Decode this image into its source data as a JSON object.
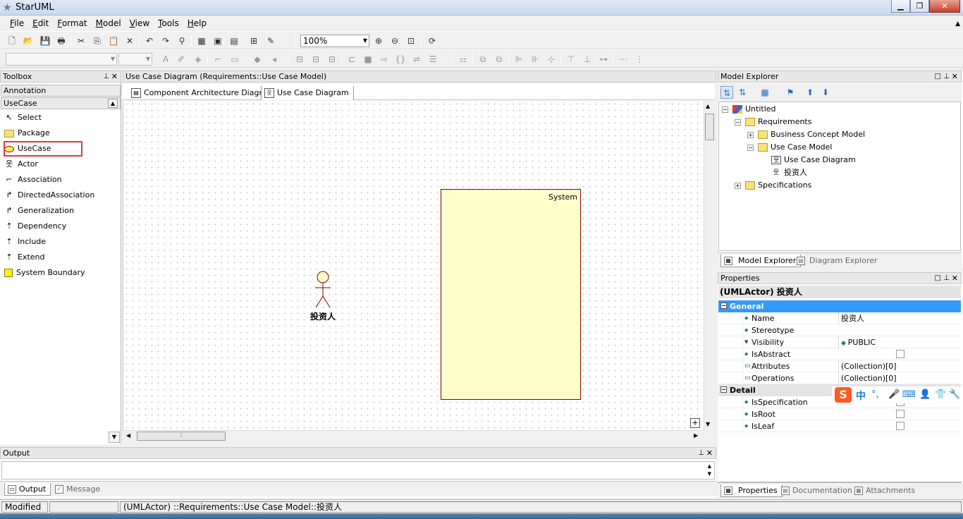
{
  "window": {
    "title": "StarUML",
    "minimize": "▁",
    "maximize": "❐",
    "close": "✕"
  },
  "menu": {
    "items": [
      {
        "first": "F",
        "rest": "ile"
      },
      {
        "first": "E",
        "rest": "dit"
      },
      {
        "first": "F",
        "rest": "ormat"
      },
      {
        "first": "M",
        "rest": "odel"
      },
      {
        "first": "V",
        "rest": "iew"
      },
      {
        "first": "T",
        "rest": "ools"
      },
      {
        "first": "H",
        "rest": "elp"
      }
    ]
  },
  "toolbar": {
    "zoom": "100%"
  },
  "toolbox": {
    "title": "Toolbox",
    "categories": [
      "Annotation",
      "UseCase"
    ],
    "items": [
      "Select",
      "Package",
      "UseCase",
      "Actor",
      "Association",
      "DirectedAssociation",
      "Generalization",
      "Dependency",
      "Include",
      "Extend",
      "System Boundary"
    ]
  },
  "diagram": {
    "title": "Use Case Diagram (Requirements::Use Case Model)",
    "tabs": [
      "Component Architecture Diagram",
      "Use Case Diagram"
    ],
    "system_label": "System",
    "actor_name": "投资人"
  },
  "output": {
    "title": "Output",
    "tabs": [
      "Output",
      "Message"
    ]
  },
  "model_explorer": {
    "title": "Model Explorer",
    "tree": {
      "root": "Untitled",
      "requirements": "Requirements",
      "business_concept_model": "Business Concept Model",
      "use_case_model": "Use Case Model",
      "use_case_diagram": "Use Case Diagram",
      "actor": "投资人",
      "specifications": "Specifications"
    },
    "tabs": [
      "Model Explorer",
      "Diagram Explorer"
    ]
  },
  "properties": {
    "title": "Properties",
    "header": "(UMLActor) 投资人",
    "general_label": "General",
    "detail_label": "Detail",
    "general": [
      {
        "key": "Name",
        "value": "投资人"
      },
      {
        "key": "Stereotype",
        "value": ""
      },
      {
        "key": "Visibility",
        "value": "PUBLIC"
      },
      {
        "key": "IsAbstract",
        "value": ""
      },
      {
        "key": "Attributes",
        "value": "(Collection)[0]"
      },
      {
        "key": "Operations",
        "value": "(Collection)[0]"
      }
    ],
    "detail": [
      {
        "key": "IsSpecification",
        "value": ""
      },
      {
        "key": "IsRoot",
        "value": ""
      },
      {
        "key": "IsLeaf",
        "value": ""
      }
    ],
    "tabs": [
      "Properties",
      "Documentation",
      "Attachments"
    ]
  },
  "ime": {
    "logo": "S",
    "lang": "中"
  },
  "status": {
    "mode": "Modified",
    "empty": "",
    "path": "(UMLActor) ::Requirements::Use Case Model::投资人"
  },
  "colors": {
    "selection": "#3399ff",
    "system_fill": "#ffffcc",
    "highlight": "#e0393e"
  }
}
